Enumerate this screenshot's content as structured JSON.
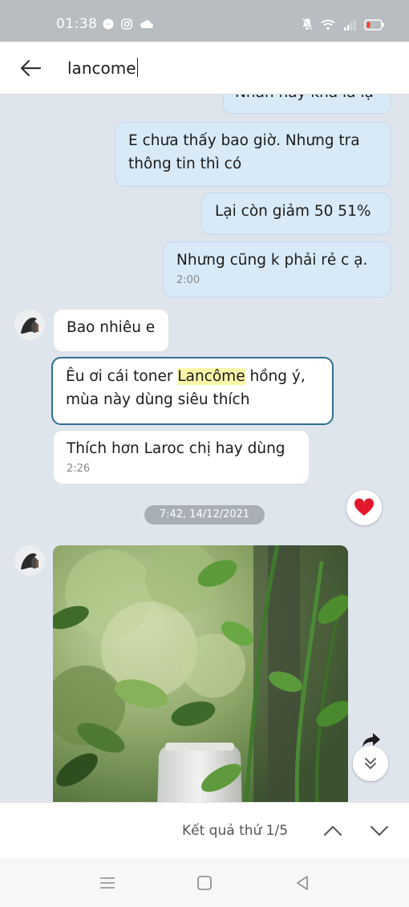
{
  "status_bar": {
    "time": "01:38",
    "notification_icons": [
      "messenger-icon",
      "instagram-icon",
      "cloud-icon"
    ],
    "right_icons": [
      "mute-icon",
      "wifi-icon",
      "signal-icon",
      "battery-low-icon"
    ],
    "battery_color": "#ff3b30"
  },
  "header": {
    "search_query": "lancome",
    "back_icon": "arrow-left-icon"
  },
  "messages": [
    {
      "side": "out",
      "text": "Nhắn hay khá là lạ"
    },
    {
      "side": "out",
      "text": "E chưa thấy bao giờ. Nhưng tra thông tin thì có"
    },
    {
      "side": "out",
      "text": "Lại còn giảm 50 51%"
    },
    {
      "side": "out",
      "text": "Nhưng cũng k phải rẻ c ạ.",
      "time": "2:00"
    },
    {
      "side": "in",
      "text": "Bao nhiêu e"
    },
    {
      "side": "in",
      "text_before": "Êu ơi cái toner ",
      "highlight": "Lancôme",
      "text_after": " hồng ý, mùa này dùng siêu thích",
      "highlighted_result": true
    },
    {
      "side": "in",
      "text": "Thích hơn Laroc chị hay dùng",
      "time": "2:26"
    }
  ],
  "date_separator": "7:42, 14/12/2021",
  "reaction": "heart-icon",
  "result_bar": {
    "label": "Kết quả thứ 1/5"
  },
  "colors": {
    "outgoing_bubble": "#d8eaf8",
    "incoming_bubble": "#ffffff",
    "chat_background": "#dfe5ec",
    "highlight": "#fbf5a8",
    "active_border": "#2f6f8f",
    "heart": "#e2192c"
  }
}
